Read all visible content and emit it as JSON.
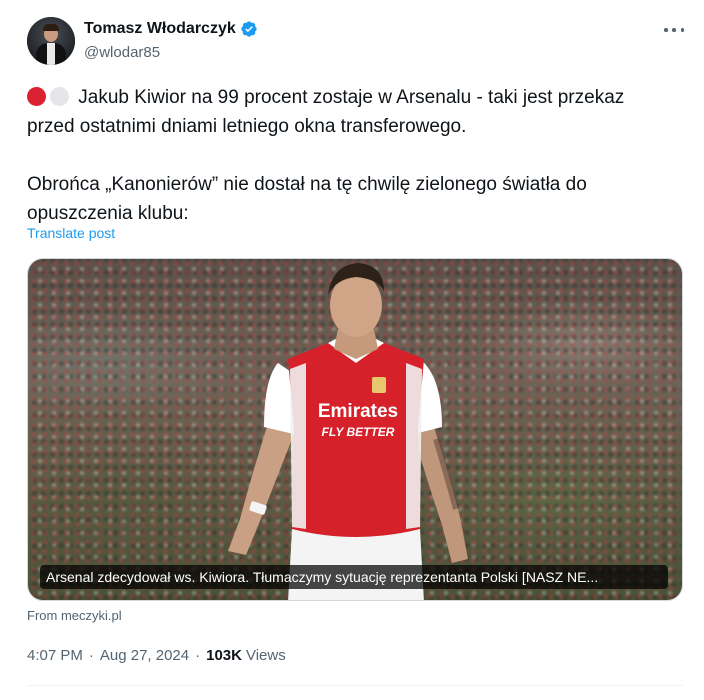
{
  "author": {
    "name": "Tomasz Włodarczyk",
    "handle": "@wlodar85",
    "verified": true
  },
  "tweet": {
    "line1": "Jakub Kiwior na 99 procent zostaje w Arsenalu - taki jest przekaz przed ostatnimi dniami letniego okna transferowego.",
    "line2": "Obrońca „Kanonierów” nie dostał na tę chwilę zielonego światła do opuszczenia klubu:",
    "emoji_colors": [
      "#dc2133",
      "#e6e6ea"
    ],
    "translate_label": "Translate post"
  },
  "card": {
    "caption": "Arsenal zdecydował ws. Kiwiora. Tłumaczymy sytuację reprezentanta Polski [NASZ NE...",
    "source": "From meczyki.pl",
    "jersey_sponsor_1": "Emirates",
    "jersey_sponsor_2": "FLY BETTER"
  },
  "meta": {
    "time": "4:07 PM",
    "date": "Aug 27, 2024",
    "views_count": "103K",
    "views_label": "Views",
    "separator": "·"
  },
  "colors": {
    "link": "#1d9bf0",
    "secondary_text": "#536471",
    "verified_badge": "#1d9bf0",
    "arsenal_red": "#d6202a"
  },
  "icons": {
    "verified": "verified-badge-icon",
    "more": "more-horizontal-icon"
  }
}
